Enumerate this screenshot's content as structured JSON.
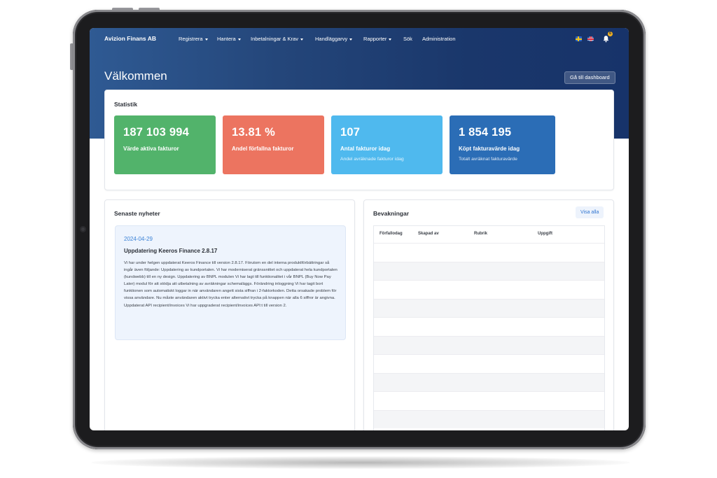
{
  "app": {
    "brand": "Avizion Finans AB"
  },
  "nav": {
    "items": [
      {
        "label": "Registrera",
        "dropdown": true
      },
      {
        "label": "Hantera",
        "dropdown": true
      },
      {
        "label": "Inbetalningar & Krav",
        "dropdown": true
      },
      {
        "label": "Handläggarvy",
        "dropdown": true
      },
      {
        "label": "Rapporter",
        "dropdown": true
      },
      {
        "label": "Sök",
        "dropdown": false
      },
      {
        "label": "Administration",
        "dropdown": false
      }
    ],
    "languages": [
      "swedish-flag-icon",
      "uk-flag-icon"
    ],
    "notification_count": "6"
  },
  "page": {
    "title": "Välkommen",
    "dashboard_button": "Gå till dashboard"
  },
  "stats": {
    "title": "Statistik",
    "cards": [
      {
        "value": "187 103 994",
        "label": "Värde aktiva fakturor",
        "sub": "",
        "color": "#52b36b"
      },
      {
        "value": "13.81 %",
        "label": "Andel förfallna fakturor",
        "sub": "",
        "color": "#ec7460"
      },
      {
        "value": "107",
        "label": "Antal fakturor idag",
        "sub": "Andel avräknade fakturor idag",
        "color": "#4fb9ee"
      },
      {
        "value": "1 854 195",
        "label": "Köpt fakturavärde idag",
        "sub": "Totalt avräknat fakturavärde",
        "color": "#2b6db6"
      }
    ]
  },
  "news": {
    "title": "Senaste nyheter",
    "date": "2024-04-29",
    "headline": "Uppdatering Keeros Finance 2.8.17",
    "body": "Vi har under helgen uppdaterat Keeros Finance till version 2.8.17. Förutom en del interna produktförbättringar så ingår även följande: Uppdatering av kundportalen. Vi har moderniserat gränssnittet och uppdaterat hela kundportalen (kundwebb) till en ny design. Uppdatering av BNPL modulen Vi har lagt till funktionalitet i vår BNPL (Buy Now Pay Later) modul för att stödja att utbetalning av avräkningar schemaläggs. Förändring inloggning Vi har tagit bort funktionen som automatiskt loggar in när användaren angett sista siffran i 2-faktorkoden. Detta orsakade problem för vissa användare. Nu måste användaren aktivt trycka enter alternativt trycka på knappen när alla 6 siffror är angivna. Uppdaterat API recipient/invoices Vi har uppgraderat recipient/invoices API:t till version 2."
  },
  "watch": {
    "title": "Bevakningar",
    "show_all": "Visa alla",
    "columns": [
      "Förfallodag",
      "Skapad av",
      "Rubrik",
      "Uppgift"
    ],
    "rows": []
  }
}
